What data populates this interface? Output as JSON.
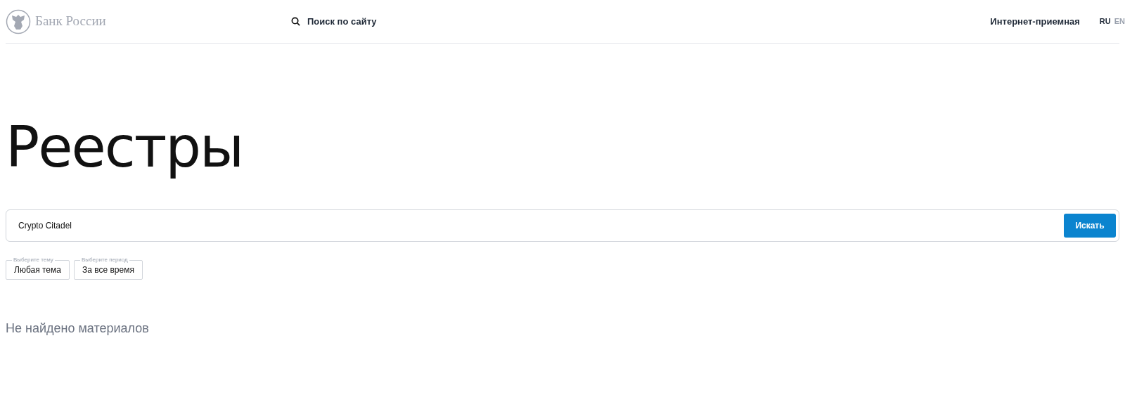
{
  "header": {
    "logo_text": "Банк России",
    "search_link": "Поиск по сайту",
    "reception_link": "Интернет-приемная",
    "languages": [
      {
        "label": "RU",
        "selected": true
      },
      {
        "label": "EN",
        "selected": false
      }
    ]
  },
  "title": "Реестры",
  "search": {
    "value": "Crypto Citadel",
    "button": "Искать"
  },
  "filters": [
    {
      "legend": "Выберите тему",
      "value": "Любая тема"
    },
    {
      "legend": "Выберите период",
      "value": "За все время"
    }
  ],
  "result_message": "Не найдено материалов"
}
